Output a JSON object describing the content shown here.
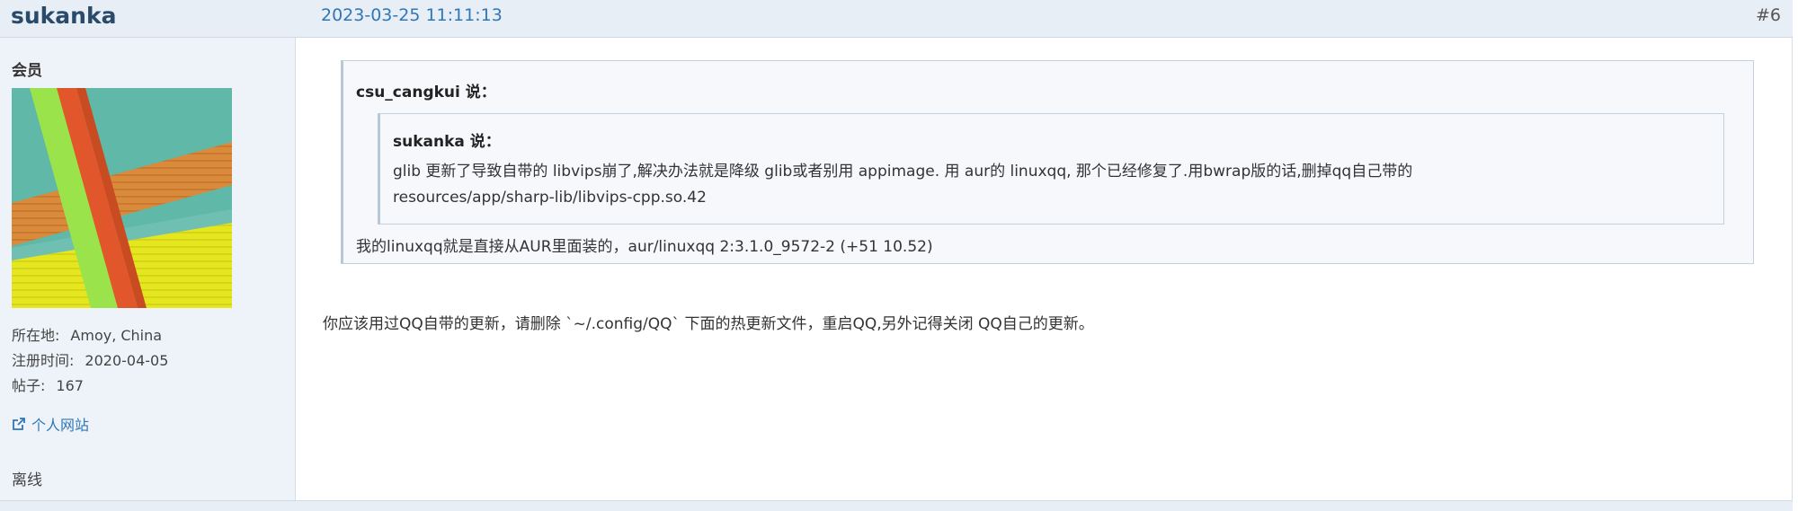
{
  "header": {
    "author": "sukanka",
    "datetime": "2023-03-25 11:11:13",
    "post_number": "#6"
  },
  "user": {
    "rank": "会员",
    "avatar_icon": "striped-avatar-icon",
    "location_label": "所在地:",
    "location_value": "Amoy, China",
    "registered_label": "注册时间:",
    "registered_value": "2020-04-05",
    "posts_label": "帖子:",
    "posts_value": "167",
    "website_label": "个人网站",
    "website_icon": "external-link-icon",
    "status": "离线"
  },
  "post": {
    "outer_quote_author": "csu_cangkui 说：",
    "inner_quote_author": "sukanka 说：",
    "inner_quote_line1": "glib 更新了导致自带的 libvips崩了,解决办法就是降级 glib或者别用 appimage. 用 aur的 linuxqq, 那个已经修复了.用bwrap版的话,删掉qq自己带的",
    "inner_quote_line2": "resources/app/sharp-lib/libvips-cpp.so.42",
    "outer_quote_reply": "我的linuxqq就是直接从AUR里面装的，aur/linuxqq 2:3.1.0_9572-2 (+51 10.52)",
    "body": "你应该用过QQ自带的更新，请删除 `~/.config/QQ` 下面的热更新文件，重启QQ,另外记得关闭 QQ自己的更新。"
  },
  "colors": {
    "header_bg": "#e8eef5",
    "sidebar_bg": "#eef3f9",
    "link": "#2f77b7",
    "quote_bg": "#f6f8fb"
  }
}
